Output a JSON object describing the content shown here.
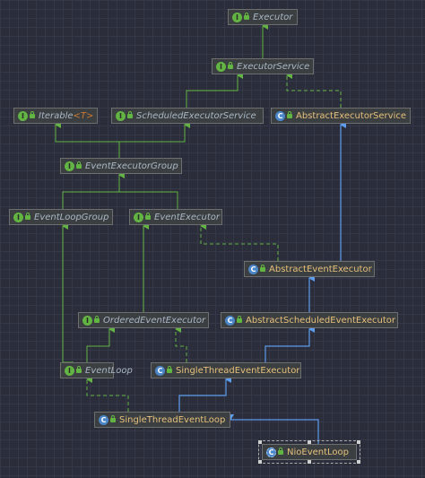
{
  "nodes": [
    {
      "id": "executor",
      "label": "Executor",
      "kind": "interface"
    },
    {
      "id": "executorService",
      "label": "ExecutorService",
      "kind": "interface"
    },
    {
      "id": "iterable",
      "label": "Iterable",
      "generic": "<T>",
      "kind": "interface"
    },
    {
      "id": "scheduledExecutorService",
      "label": "ScheduledExecutorService",
      "kind": "interface"
    },
    {
      "id": "abstractExecutorService",
      "label": "AbstractExecutorService",
      "kind": "abstract"
    },
    {
      "id": "eventExecutorGroup",
      "label": "EventExecutorGroup",
      "kind": "interface"
    },
    {
      "id": "eventLoopGroup",
      "label": "EventLoopGroup",
      "kind": "interface"
    },
    {
      "id": "eventExecutor",
      "label": "EventExecutor",
      "kind": "interface"
    },
    {
      "id": "abstractEventExecutor",
      "label": "AbstractEventExecutor",
      "kind": "abstract"
    },
    {
      "id": "orderedEventExecutor",
      "label": "OrderedEventExecutor",
      "kind": "interface"
    },
    {
      "id": "abstractScheduledEventExecutor",
      "label": "AbstractScheduledEventExecutor",
      "kind": "abstract"
    },
    {
      "id": "eventLoop",
      "label": "EventLoop",
      "kind": "interface"
    },
    {
      "id": "singleThreadEventExecutor",
      "label": "SingleThreadEventExecutor",
      "kind": "abstract"
    },
    {
      "id": "singleThreadEventLoop",
      "label": "SingleThreadEventLoop",
      "kind": "abstract"
    },
    {
      "id": "nioEventLoop",
      "label": "NioEventLoop",
      "kind": "class",
      "selected": true
    }
  ],
  "edges": [
    {
      "from": "executorService",
      "to": "executor",
      "type": "extends-interface"
    },
    {
      "from": "scheduledExecutorService",
      "to": "executorService",
      "type": "extends-interface"
    },
    {
      "from": "abstractExecutorService",
      "to": "executorService",
      "type": "implements"
    },
    {
      "from": "eventExecutorGroup",
      "to": "iterable",
      "type": "extends-interface"
    },
    {
      "from": "eventExecutorGroup",
      "to": "scheduledExecutorService",
      "type": "extends-interface"
    },
    {
      "from": "eventLoopGroup",
      "to": "eventExecutorGroup",
      "type": "extends-interface"
    },
    {
      "from": "eventExecutor",
      "to": "eventExecutorGroup",
      "type": "extends-interface"
    },
    {
      "from": "abstractEventExecutor",
      "to": "eventExecutor",
      "type": "implements"
    },
    {
      "from": "abstractEventExecutor",
      "to": "abstractExecutorService",
      "type": "extends-class"
    },
    {
      "from": "orderedEventExecutor",
      "to": "eventExecutor",
      "type": "extends-interface"
    },
    {
      "from": "abstractScheduledEventExecutor",
      "to": "abstractEventExecutor",
      "type": "extends-class"
    },
    {
      "from": "eventLoop",
      "to": "eventLoopGroup",
      "type": "extends-interface"
    },
    {
      "from": "eventLoop",
      "to": "orderedEventExecutor",
      "type": "extends-interface"
    },
    {
      "from": "singleThreadEventExecutor",
      "to": "orderedEventExecutor",
      "type": "implements"
    },
    {
      "from": "singleThreadEventExecutor",
      "to": "abstractScheduledEventExecutor",
      "type": "extends-class"
    },
    {
      "from": "singleThreadEventLoop",
      "to": "eventLoop",
      "type": "implements"
    },
    {
      "from": "singleThreadEventLoop",
      "to": "singleThreadEventExecutor",
      "type": "extends-class"
    },
    {
      "from": "nioEventLoop",
      "to": "singleThreadEventLoop",
      "type": "extends-class"
    }
  ],
  "colors": {
    "background": "#2b2d3a",
    "interfaceEdge": "#62b543",
    "classEdge": "#5c9ded",
    "interfaceText": "#a9b7c6",
    "classText": "#e6c07b"
  }
}
